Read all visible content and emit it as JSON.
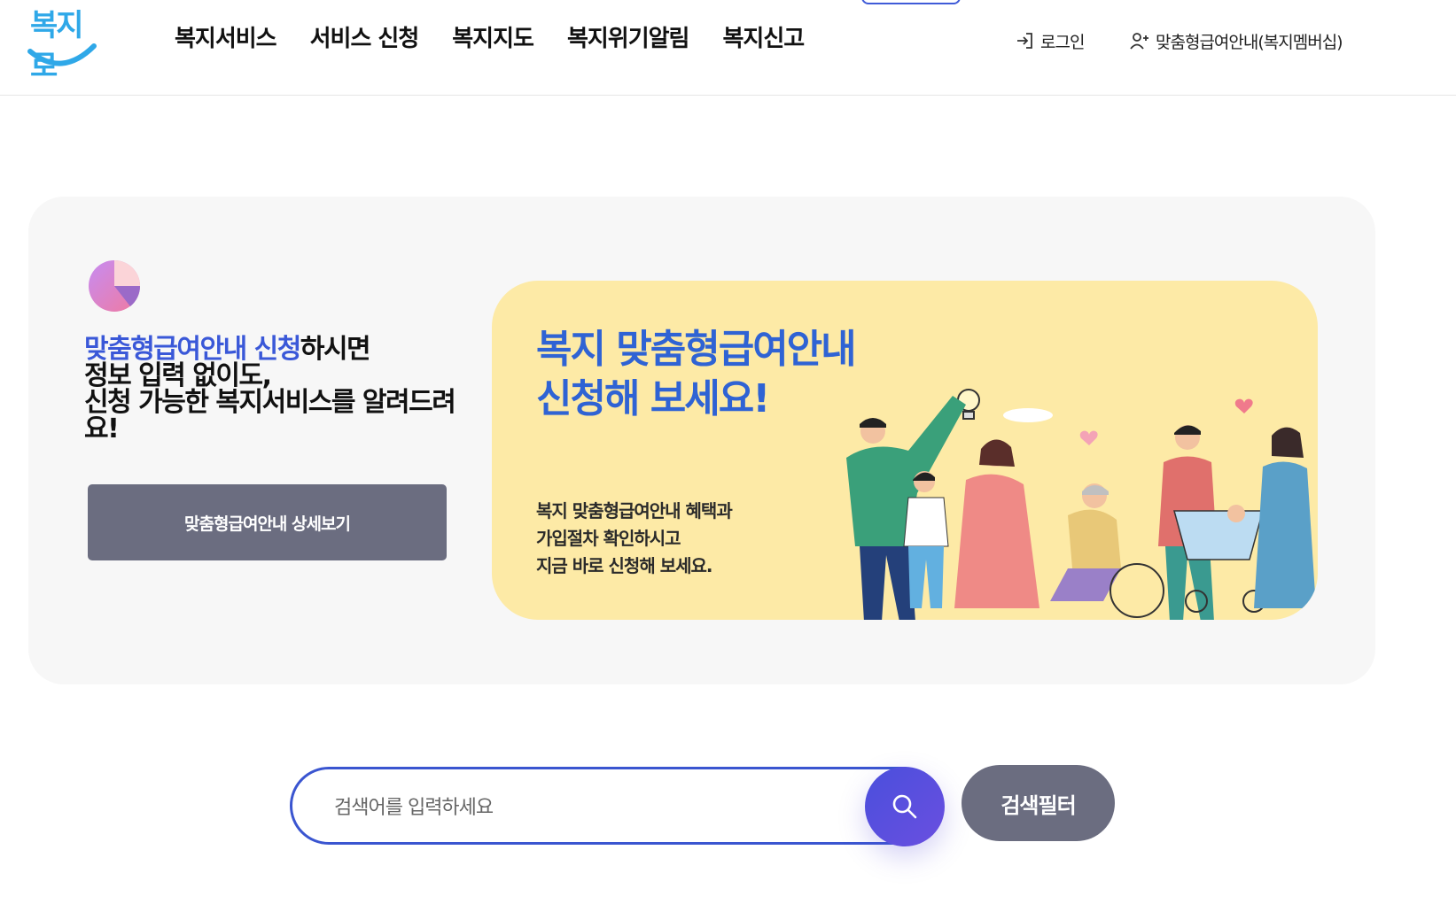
{
  "header": {
    "logo_text": "복지로",
    "nav": [
      "복지서비스",
      "서비스 신청",
      "복지지도",
      "복지위기알림",
      "복지신고"
    ],
    "login_label": "로그인",
    "membership_label": "맞춤형급여안내(복지멤버십)"
  },
  "promo": {
    "highlight1": "맞춤형급여안내 신청",
    "rest1": "하시면",
    "line2": "정보 입력 없이도,",
    "line3": "신청 가능한 복지서비스를 알려드려요!",
    "button_label": "맞춤형급여안내 상세보기"
  },
  "banner": {
    "title_line1": "복지 맞춤형급여안내",
    "title_line2": "신청해 보세요!",
    "desc_line1": "복지 맞춤형급여안내 혜택과",
    "desc_line2": "가입절차 확인하시고",
    "desc_line3": "지금 바로 신청해 보세요."
  },
  "search": {
    "placeholder": "검색어를 입력하세요",
    "filter_label": "검색필터"
  },
  "colors": {
    "accent": "#3a58d8",
    "button_gray": "#6b6d80",
    "banner_bg": "#fdeaa6",
    "panel_bg": "#f7f7f7"
  }
}
